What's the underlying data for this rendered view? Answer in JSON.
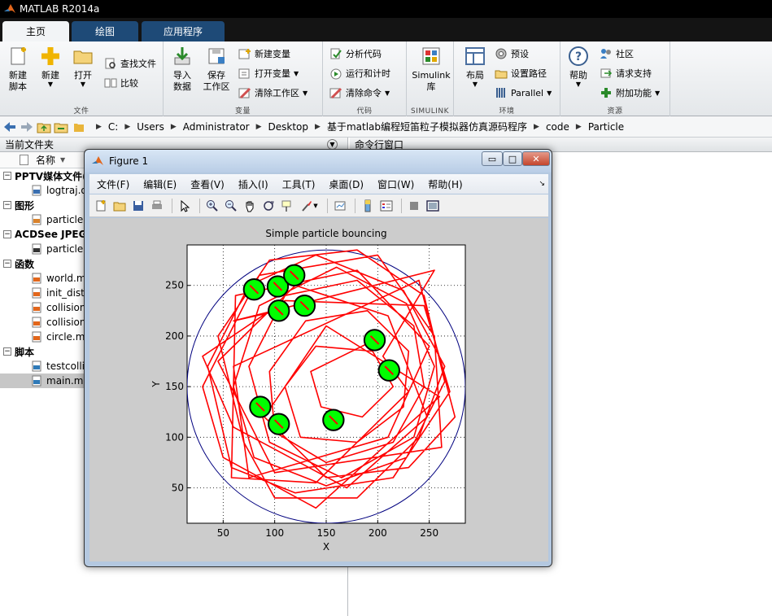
{
  "titlebar": {
    "title": "MATLAB R2014a"
  },
  "tabs": [
    {
      "label": "主页"
    },
    {
      "label": "绘图"
    },
    {
      "label": "应用程序"
    }
  ],
  "ribbon": {
    "file": {
      "label": "文件",
      "new_script": "新建\n脚本",
      "new": "新建",
      "open": "打开",
      "find_files": "查找文件",
      "compare": "比较"
    },
    "variable": {
      "label": "变量",
      "import": "导入\n数据",
      "save_ws": "保存\n工作区",
      "new_var": "新建变量",
      "open_var": "打开变量",
      "clear_ws": "清除工作区"
    },
    "code": {
      "label": "代码",
      "analyze": "分析代码",
      "run_time": "运行和计时",
      "clear_cmd": "清除命令"
    },
    "simulink": {
      "label": "SIMULINK",
      "lib": "Simulink\n库"
    },
    "env": {
      "label": "环境",
      "layout": "布局",
      "prefs": "预设",
      "set_path": "设置路径",
      "parallel": "Parallel"
    },
    "resources": {
      "label": "资源",
      "help": "帮助",
      "community": "社区",
      "support": "请求支持",
      "addons": "附加功能"
    }
  },
  "breadcrumb": [
    "C:",
    "Users",
    "Administrator",
    "Desktop",
    "基于matlab编程短笛粒子模拟器仿真源码程序",
    "code",
    "Particle"
  ],
  "current_folder": {
    "title": "当前文件夹",
    "column_name": "名称",
    "groups": [
      {
        "label": "PPTV媒体文件(",
        "files": [
          {
            "name": "logtraj.o",
            "icon": "log-file-icon"
          }
        ]
      },
      {
        "label": "图形",
        "files": [
          {
            "name": "particleb",
            "icon": "figure-file-icon"
          }
        ]
      },
      {
        "label": "ACDSee JPEG",
        "files": [
          {
            "name": "particleb",
            "icon": "jpeg-file-icon"
          }
        ]
      },
      {
        "label": "函数",
        "files": [
          {
            "name": "world.m",
            "icon": "function-file-icon"
          },
          {
            "name": "init_distr",
            "icon": "function-file-icon"
          },
          {
            "name": "collision",
            "icon": "function-file-icon"
          },
          {
            "name": "collision",
            "icon": "function-file-icon"
          },
          {
            "name": "circle.m",
            "icon": "function-file-icon"
          }
        ]
      },
      {
        "label": "脚本",
        "files": [
          {
            "name": "testcollis",
            "icon": "script-file-icon"
          },
          {
            "name": "main.m",
            "icon": "script-file-icon",
            "selected": true
          }
        ]
      }
    ]
  },
  "command_window": {
    "title": "命令行窗口"
  },
  "figure": {
    "title": "Figure 1",
    "menu": [
      "文件(F)",
      "编辑(E)",
      "查看(V)",
      "插入(I)",
      "工具(T)",
      "桌面(D)",
      "窗口(W)",
      "帮助(H)"
    ],
    "buttons": {
      "minimize": "▭",
      "maximize": "□",
      "close": "✕"
    }
  },
  "chart_data": {
    "type": "scatter",
    "title": "Simple particle bouncing",
    "xlabel": "X",
    "ylabel": "Y",
    "xlim": [
      15,
      285
    ],
    "ylim": [
      15,
      290
    ],
    "xticks": [
      50,
      100,
      150,
      200,
      250
    ],
    "yticks": [
      50,
      100,
      150,
      200,
      250
    ],
    "grid": "dotted",
    "boundary_circle": {
      "cx": 150,
      "cy": 150,
      "r": 135,
      "color": "#00007f"
    },
    "particle_radius": 10,
    "particle_color": "#00ff00",
    "trajectory_color": "#ff0000",
    "particles": [
      {
        "x": 80,
        "y": 246
      },
      {
        "x": 103,
        "y": 249
      },
      {
        "x": 119,
        "y": 260
      },
      {
        "x": 104,
        "y": 225
      },
      {
        "x": 129,
        "y": 230
      },
      {
        "x": 197,
        "y": 196
      },
      {
        "x": 211,
        "y": 166
      },
      {
        "x": 86,
        "y": 130
      },
      {
        "x": 104,
        "y": 113
      },
      {
        "x": 157,
        "y": 117
      }
    ],
    "trajectory": [
      [
        104,
        225
      ],
      [
        60,
        215
      ],
      [
        255,
        265
      ],
      [
        205,
        180
      ],
      [
        230,
        145
      ],
      [
        140,
        55
      ],
      [
        58,
        60
      ],
      [
        62,
        240
      ],
      [
        180,
        265
      ],
      [
        250,
        190
      ],
      [
        210,
        100
      ],
      [
        75,
        60
      ],
      [
        60,
        170
      ],
      [
        240,
        255
      ],
      [
        275,
        120
      ],
      [
        230,
        70
      ],
      [
        150,
        60
      ],
      [
        90,
        120
      ],
      [
        150,
        210
      ],
      [
        260,
        140
      ],
      [
        140,
        30
      ],
      [
        50,
        80
      ],
      [
        30,
        150
      ],
      [
        85,
        260
      ],
      [
        200,
        280
      ],
      [
        255,
        200
      ],
      [
        262,
        90
      ],
      [
        100,
        65
      ],
      [
        45,
        175
      ],
      [
        120,
        250
      ],
      [
        210,
        220
      ],
      [
        248,
        120
      ],
      [
        170,
        50
      ],
      [
        60,
        110
      ],
      [
        30,
        180
      ],
      [
        110,
        235
      ],
      [
        245,
        230
      ],
      [
        270,
        145
      ],
      [
        215,
        60
      ],
      [
        120,
        45
      ],
      [
        58,
        70
      ],
      [
        35,
        170
      ],
      [
        75,
        250
      ],
      [
        140,
        280
      ],
      [
        225,
        245
      ],
      [
        265,
        170
      ],
      [
        240,
        100
      ],
      [
        180,
        40
      ],
      [
        100,
        40
      ],
      [
        70,
        95
      ],
      [
        45,
        200
      ],
      [
        95,
        275
      ],
      [
        180,
        285
      ],
      [
        245,
        240
      ],
      [
        265,
        155
      ],
      [
        228,
        80
      ],
      [
        150,
        52
      ],
      [
        80,
        80
      ],
      [
        60,
        150
      ],
      [
        85,
        230
      ],
      [
        160,
        268
      ],
      [
        228,
        232
      ],
      [
        255,
        170
      ],
      [
        235,
        100
      ],
      [
        165,
        60
      ],
      [
        95,
        95
      ],
      [
        75,
        170
      ],
      [
        110,
        240
      ],
      [
        180,
        255
      ],
      [
        235,
        210
      ],
      [
        245,
        150
      ],
      [
        215,
        95
      ],
      [
        150,
        75
      ],
      [
        100,
        105
      ],
      [
        95,
        165
      ],
      [
        130,
        215
      ],
      [
        190,
        225
      ],
      [
        230,
        185
      ],
      [
        225,
        130
      ],
      [
        180,
        95
      ],
      [
        125,
        100
      ],
      [
        110,
        150
      ],
      [
        140,
        190
      ],
      [
        195,
        185
      ],
      [
        215,
        150
      ],
      [
        185,
        120
      ],
      [
        145,
        130
      ],
      [
        135,
        165
      ],
      [
        165,
        180
      ],
      [
        197,
        196
      ]
    ]
  }
}
